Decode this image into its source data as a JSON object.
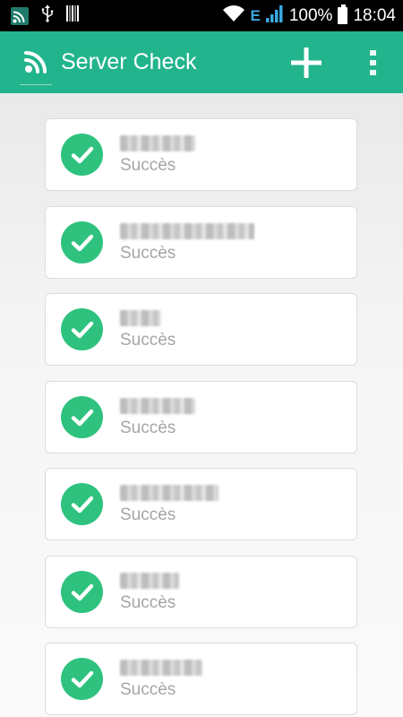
{
  "status_bar": {
    "battery": "100%",
    "time": "18:04",
    "network": "E"
  },
  "app_bar": {
    "title": "Server Check",
    "add_icon": "plus-icon",
    "menu_icon": "overflow-menu-icon",
    "color": "#22b48c"
  },
  "servers": [
    {
      "name": "██████",
      "status": "Succès"
    },
    {
      "name": "█████████████",
      "status": "Succès"
    },
    {
      "name": "████",
      "status": "Succès"
    },
    {
      "name": "███████",
      "status": "Succès"
    },
    {
      "name": "████████████",
      "status": "Succès"
    },
    {
      "name": "██████",
      "status": "Succès"
    },
    {
      "name": "████████",
      "status": "Succès"
    }
  ],
  "colors": {
    "success": "#2ec27e",
    "accent": "#22b48c"
  }
}
